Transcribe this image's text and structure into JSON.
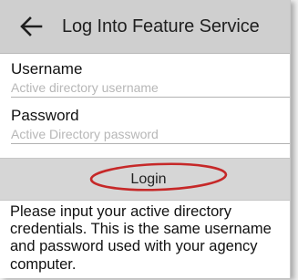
{
  "header": {
    "title": "Log Into Feature Service",
    "back_icon": "arrow-left-icon"
  },
  "form": {
    "username_label": "Username",
    "username_placeholder": "Active directory username",
    "username_value": "",
    "password_label": "Password",
    "password_placeholder": "Active Directory password",
    "password_value": ""
  },
  "actions": {
    "login_label": "Login"
  },
  "annotation": {
    "color": "#c62828"
  },
  "message": {
    "text": "Please input your active directory credentials. This is the same username and password used with your agency computer."
  },
  "colors": {
    "header_bg": "#cfcfcf",
    "login_bar_bg": "#d6d6d6",
    "text": "#111111",
    "placeholder": "#b7b7b7"
  }
}
